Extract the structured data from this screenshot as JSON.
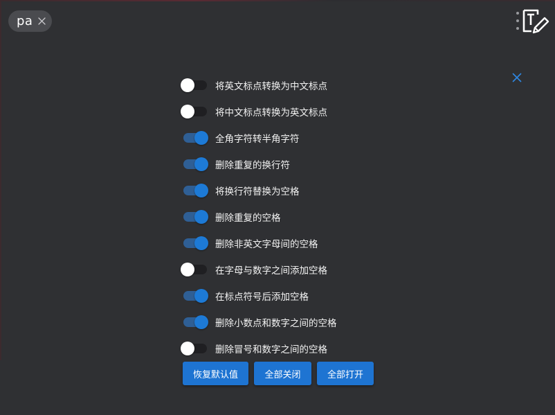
{
  "tab_chip": {
    "label": "pa",
    "close_icon": "close-icon"
  },
  "header": {
    "menu_icon": "kebab-menu-icon",
    "logo_icon": "text-edit-logo-icon"
  },
  "panel": {
    "close_icon": "close-icon"
  },
  "options": [
    {
      "label": "将英文标点转换为中文标点",
      "enabled": false
    },
    {
      "label": "将中文标点转换为英文标点",
      "enabled": false
    },
    {
      "label": "全角字符转半角字符",
      "enabled": true
    },
    {
      "label": "删除重复的换行符",
      "enabled": true
    },
    {
      "label": "将换行符替换为空格",
      "enabled": true
    },
    {
      "label": "删除重复的空格",
      "enabled": true
    },
    {
      "label": "删除非英文字母间的空格",
      "enabled": true
    },
    {
      "label": "在字母与数字之间添加空格",
      "enabled": false
    },
    {
      "label": "在标点符号后添加空格",
      "enabled": true
    },
    {
      "label": "删除小数点和数字之间的空格",
      "enabled": true
    },
    {
      "label": "删除冒号和数字之间的空格",
      "enabled": false
    }
  ],
  "buttons": {
    "restore_defaults": "恢复默认值",
    "all_off": "全部关闭",
    "all_on": "全部打开"
  },
  "colors": {
    "background": "#2f3033",
    "accent": "#1e74d2",
    "toggle_on_track": "#2f5f95",
    "toggle_off_track": "#1f1f22"
  }
}
